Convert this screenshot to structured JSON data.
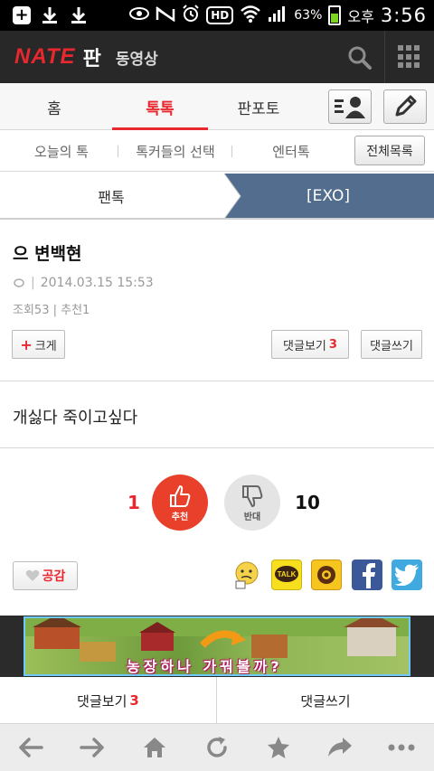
{
  "status_bar": {
    "battery": "63%",
    "ampm": "오후",
    "time": "3:56",
    "hd": "HD"
  },
  "app_bar": {
    "logo": "NATE",
    "pan": "판",
    "video": "동영상"
  },
  "tabs": [
    {
      "label": "홈",
      "active": false
    },
    {
      "label": "톡톡",
      "active": true
    },
    {
      "label": "판포토",
      "active": false
    }
  ],
  "subnav": {
    "items": [
      "오늘의 톡",
      "톡커들의 선택",
      "엔터톡"
    ],
    "all_list": "전체목록"
  },
  "breadcrumb": {
    "left": "팬톡",
    "right": "[EXO]"
  },
  "post": {
    "title": "으 변백현",
    "date": "2014.03.15 15:53",
    "stats": "조회53 | 추천1",
    "bigger": "크게",
    "comments_view": "댓글보기",
    "comment_count": "3",
    "comments_write": "댓글쓰기",
    "body": "개싫다 죽이고싶다"
  },
  "vote": {
    "up_count": "1",
    "up_label": "추천",
    "down_label": "반대",
    "down_count": "10"
  },
  "share": {
    "empathy": "공감"
  },
  "ad": {
    "text": "농장하나 가꿔볼까?"
  },
  "comment_bar": {
    "view": "댓글보기",
    "count": "3",
    "write": "댓글쓰기"
  },
  "colors": {
    "accent": "#e8272e",
    "header_bg": "#282828",
    "crumb_bg": "#536d8f"
  }
}
